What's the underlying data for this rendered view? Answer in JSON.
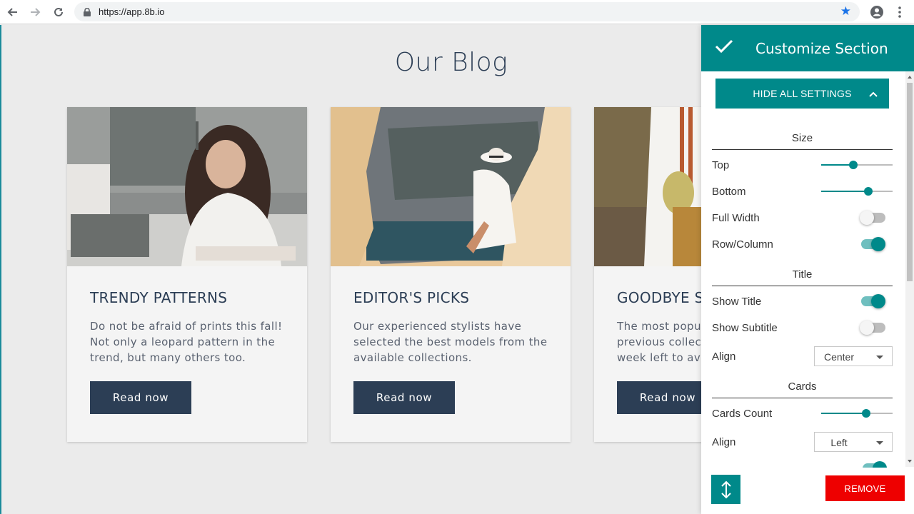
{
  "browser": {
    "url": "https://app.8b.io"
  },
  "page": {
    "title": "Our Blog",
    "cards": [
      {
        "title": "TRENDY PATTERNS",
        "text": "Do not be afraid of prints this fall! Not only a leopard pattern in the trend, but many others too.",
        "button": "Read now"
      },
      {
        "title": "EDITOR'S PICKS",
        "text": "Our experienced stylists have selected the best models from the available collections.",
        "button": "Read now"
      },
      {
        "title": "GOODBYE SU",
        "text": "The most popul previous collect week left to ava",
        "button": "Read now"
      }
    ]
  },
  "panel": {
    "title": "Customize Section",
    "hide_button": "HIDE ALL SETTINGS",
    "sections": {
      "size": {
        "title": "Size",
        "top_label": "Top",
        "top_value": 0.45,
        "bottom_label": "Bottom",
        "bottom_value": 0.66,
        "full_width_label": "Full Width",
        "full_width_on": false,
        "row_column_label": "Row/Column",
        "row_column_on": true
      },
      "title": {
        "title": "Title",
        "show_title_label": "Show Title",
        "show_title_on": true,
        "show_subtitle_label": "Show Subtitle",
        "show_subtitle_on": false,
        "align_label": "Align",
        "align_value": "Center"
      },
      "cards": {
        "title": "Cards",
        "count_label": "Cards Count",
        "count_value": 0.63,
        "align_label": "Align",
        "align_value": "Left"
      }
    },
    "remove_button": "REMOVE"
  },
  "colors": {
    "accent": "#00898a",
    "navy": "#2c3e55",
    "danger": "#ee0000"
  }
}
